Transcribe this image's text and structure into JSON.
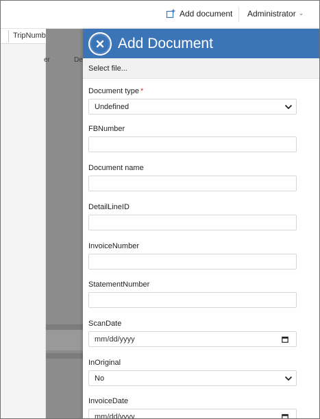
{
  "topbar": {
    "add_document": "Add document",
    "user": "Administrator",
    "accent": "#3c74b8"
  },
  "background": {
    "column_header": "TripNumber",
    "table_headers": [
      "er",
      "De"
    ]
  },
  "panel": {
    "title": "Add Document",
    "select_file": "Select file...",
    "header_color": "#3c74b8",
    "fields": {
      "document_type": {
        "label": "Document type",
        "required": "*",
        "value": "Undefined"
      },
      "fb_number": {
        "label": "FBNumber",
        "value": ""
      },
      "document_name": {
        "label": "Document name",
        "value": ""
      },
      "detail_line_id": {
        "label": "DetailLineID",
        "value": ""
      },
      "invoice_number": {
        "label": "InvoiceNumber",
        "value": ""
      },
      "statement_number": {
        "label": "StatementNumber",
        "value": ""
      },
      "scan_date": {
        "label": "ScanDate",
        "value": "mm/dd/yyyy"
      },
      "in_original": {
        "label": "InOriginal",
        "value": "No"
      },
      "invoice_date": {
        "label": "InvoiceDate",
        "value": "mm/dd/yyyy"
      }
    }
  },
  "icons": {
    "add_document": "add-document-icon",
    "close": "close-icon",
    "dropdown": "chevron-down-icon",
    "calendar": "calendar-icon"
  }
}
